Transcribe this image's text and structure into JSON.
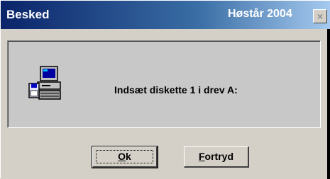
{
  "window": {
    "title": "Besked",
    "right_title": "Høstår 2004",
    "close_label": "×"
  },
  "message": {
    "text": "Indsæt diskette 1 i drev A:",
    "icon": "computer-disk-icon"
  },
  "buttons": {
    "ok_first": "O",
    "ok_rest": "k",
    "cancel_first": "F",
    "cancel_rest": "ortryd"
  },
  "colors": {
    "title_start": "#0a246a",
    "title_end": "#a6caf0",
    "face": "#d4d0c8"
  }
}
